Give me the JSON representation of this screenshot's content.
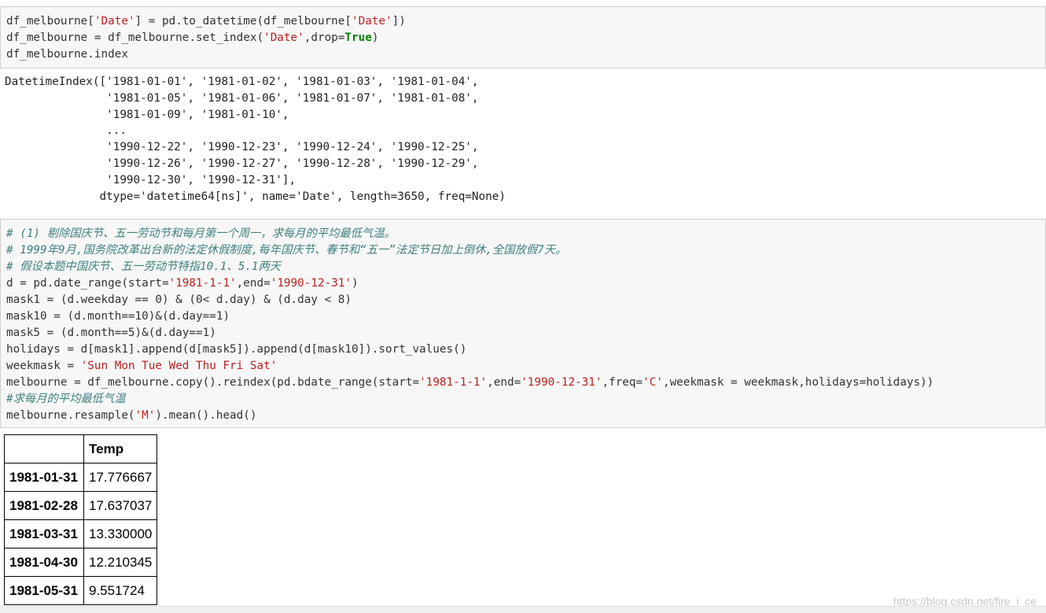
{
  "cell1": {
    "lines": [
      [
        {
          "t": "df_melbourne[",
          "c": ""
        },
        {
          "t": "'Date'",
          "c": "str"
        },
        {
          "t": "] = pd.to_datetime(df_melbourne[",
          "c": ""
        },
        {
          "t": "'Date'",
          "c": "str"
        },
        {
          "t": "])",
          "c": ""
        }
      ],
      [
        {
          "t": "df_melbourne = df_melbourne.set_index(",
          "c": ""
        },
        {
          "t": "'Date'",
          "c": "str"
        },
        {
          "t": ",drop=",
          "c": ""
        },
        {
          "t": "True",
          "c": "kw"
        },
        {
          "t": ")",
          "c": ""
        }
      ],
      [
        {
          "t": "df_melbourne.index",
          "c": ""
        }
      ]
    ]
  },
  "output1": {
    "lines": [
      "DatetimeIndex(['1981-01-01', '1981-01-02', '1981-01-03', '1981-01-04',",
      "               '1981-01-05', '1981-01-06', '1981-01-07', '1981-01-08',",
      "               '1981-01-09', '1981-01-10',",
      "               ...",
      "               '1990-12-22', '1990-12-23', '1990-12-24', '1990-12-25',",
      "               '1990-12-26', '1990-12-27', '1990-12-28', '1990-12-29',",
      "               '1990-12-30', '1990-12-31'],",
      "              dtype='datetime64[ns]', name='Date', length=3650, freq=None)"
    ]
  },
  "cell2": {
    "lines": [
      [
        {
          "t": "# (1) 剔除国庆节、五一劳动节和每月第一个周一，求每月的平均最低气温。",
          "c": "cm"
        }
      ],
      [
        {
          "t": "# 1999年9月,国务院改革出台新的法定休假制度,每年国庆节、春节和“五一”法定节日加上倒休,全国放假7天。",
          "c": "cm"
        }
      ],
      [
        {
          "t": "# 假设本题中国庆节、五一劳动节特指10.1、5.1两天",
          "c": "cm"
        }
      ],
      [
        {
          "t": "d = pd.date_range(start=",
          "c": ""
        },
        {
          "t": "'1981-1-1'",
          "c": "str"
        },
        {
          "t": ",end=",
          "c": ""
        },
        {
          "t": "'1990-12-31'",
          "c": "str"
        },
        {
          "t": ")",
          "c": ""
        }
      ],
      [
        {
          "t": "mask1 = (d.weekday == 0) & (0< d.day) & (d.day < 8)",
          "c": ""
        }
      ],
      [
        {
          "t": "mask10 = (d.month==10)&(d.day==1)",
          "c": ""
        }
      ],
      [
        {
          "t": "mask5 = (d.month==5)&(d.day==1)",
          "c": ""
        }
      ],
      [
        {
          "t": "holidays = d[mask1].append(d[mask5]).append(d[mask10]).sort_values()",
          "c": ""
        }
      ],
      [
        {
          "t": "weekmask = ",
          "c": ""
        },
        {
          "t": "'Sun Mon Tue Wed Thu Fri Sat'",
          "c": "str"
        }
      ],
      [
        {
          "t": "melbourne = df_melbourne.copy().reindex(pd.bdate_range(start=",
          "c": ""
        },
        {
          "t": "'1981-1-1'",
          "c": "str"
        },
        {
          "t": ",end=",
          "c": ""
        },
        {
          "t": "'1990-12-31'",
          "c": "str"
        },
        {
          "t": ",freq=",
          "c": ""
        },
        {
          "t": "'C'",
          "c": "str"
        },
        {
          "t": ",weekmask = weekmask,holidays=holidays))",
          "c": ""
        }
      ],
      [
        {
          "t": "#求每月的平均最低气温",
          "c": "cm"
        }
      ],
      [
        {
          "t": "melbourne.resample(",
          "c": ""
        },
        {
          "t": "'M'",
          "c": "str"
        },
        {
          "t": ").mean().head()",
          "c": ""
        }
      ]
    ]
  },
  "table": {
    "header_index": "",
    "header_col": "Temp",
    "rows": [
      {
        "index": "1981-01-31",
        "value": "17.776667"
      },
      {
        "index": "1981-02-28",
        "value": "17.637037"
      },
      {
        "index": "1981-03-31",
        "value": "13.330000"
      },
      {
        "index": "1981-04-30",
        "value": "12.210345"
      },
      {
        "index": "1981-05-31",
        "value": "9.551724"
      }
    ]
  },
  "watermark": "https://blog.csdn.net/fire_i_ce"
}
